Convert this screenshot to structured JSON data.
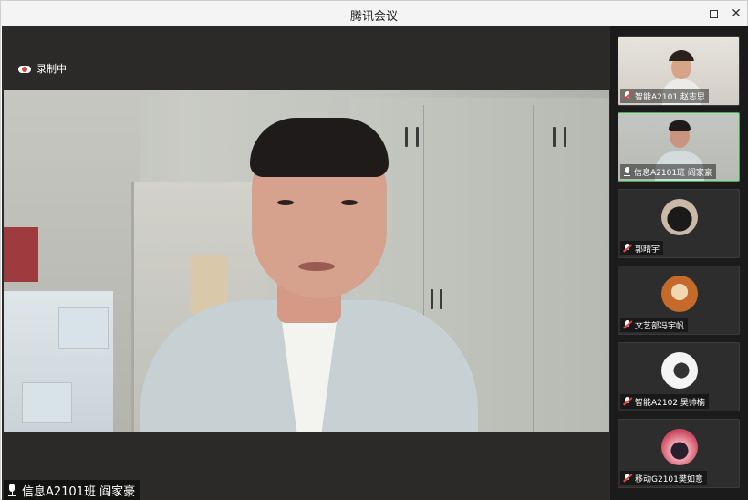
{
  "window": {
    "title": "腾讯会议"
  },
  "stage": {
    "recording_label": "录制中",
    "speaker_name": "信息A2101班 阎家豪"
  },
  "participants": [
    {
      "name": "智能A2101 赵志思",
      "mic": "muted",
      "type": "camera"
    },
    {
      "name": "信息A2101班 阎家豪",
      "mic": "on",
      "type": "camera",
      "active": true
    },
    {
      "name": "郭晴宇",
      "mic": "muted",
      "type": "avatar"
    },
    {
      "name": "文艺部冯宇帆",
      "mic": "muted",
      "type": "avatar"
    },
    {
      "name": "智能A2102 吴帅楠",
      "mic": "muted",
      "type": "avatar"
    },
    {
      "name": "移动G2101樊如意",
      "mic": "muted",
      "type": "avatar"
    }
  ],
  "colors": {
    "active_border": "#3fb24b",
    "recording_dot": "#e0433d",
    "sidebar_bg": "#1b1b1b"
  }
}
